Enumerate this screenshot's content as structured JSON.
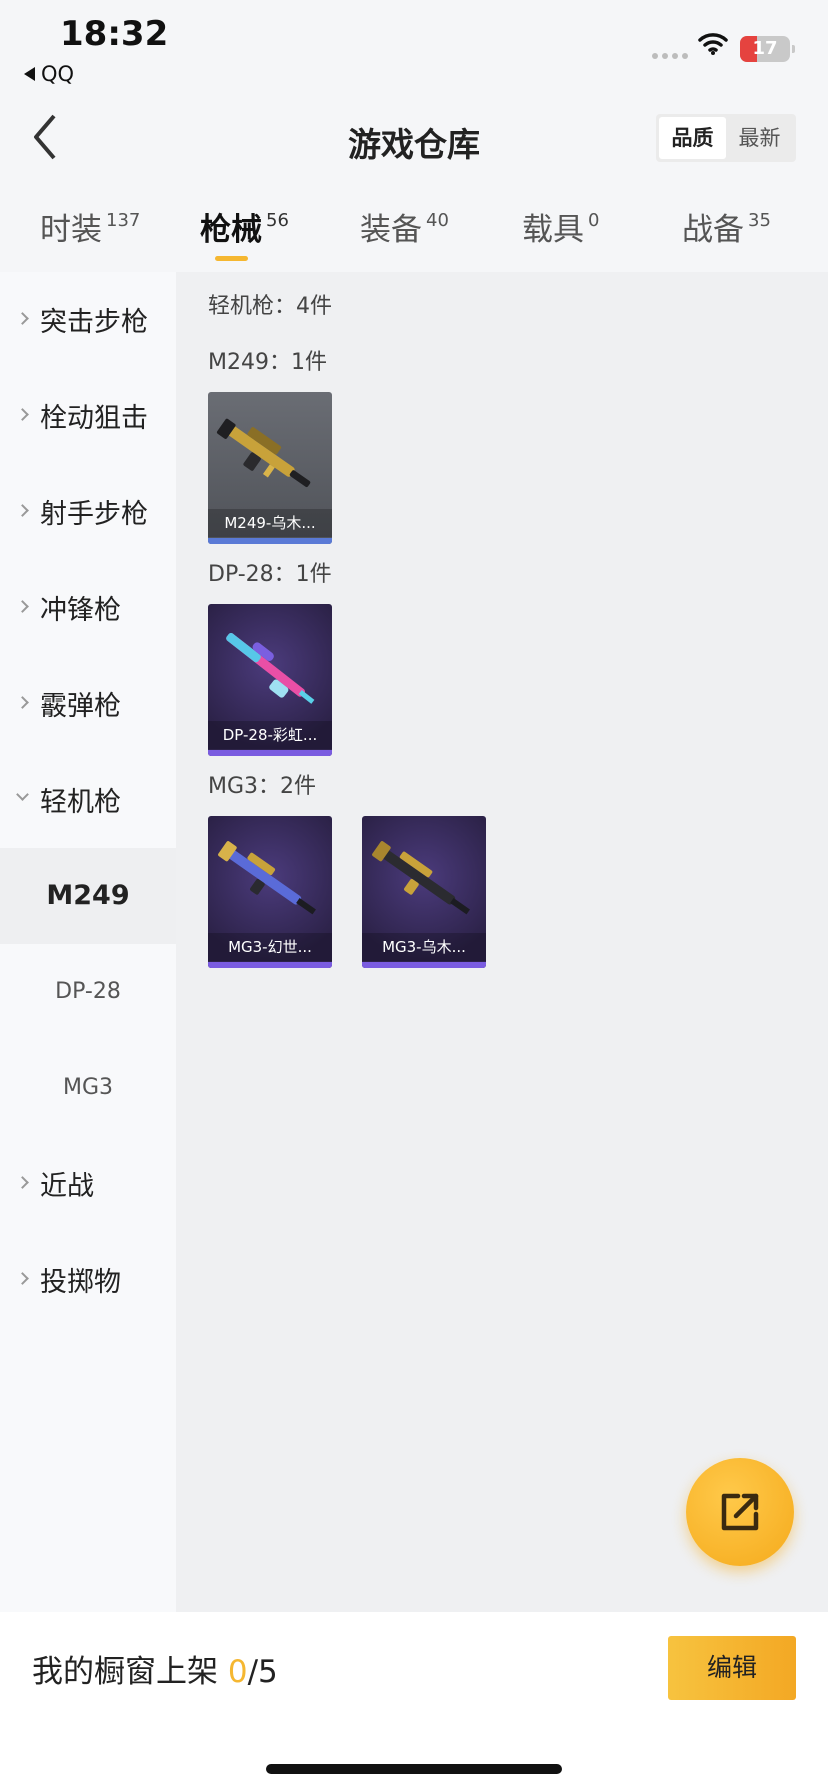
{
  "status_bar": {
    "time": "18:32",
    "back_app": "QQ",
    "battery": "17"
  },
  "header": {
    "title": "游戏仓库",
    "sort_options": [
      "品质",
      "最新"
    ]
  },
  "tabs": [
    {
      "label": "时装",
      "count": "137"
    },
    {
      "label": "枪械",
      "count": "56"
    },
    {
      "label": "装备",
      "count": "40"
    },
    {
      "label": "载具",
      "count": "0"
    },
    {
      "label": "战备",
      "count": "35"
    }
  ],
  "sidebar": {
    "categories": [
      "突击步枪",
      "栓动狙击",
      "射手步枪",
      "冲锋枪",
      "霰弹枪",
      "轻机枪",
      "近战",
      "投掷物"
    ],
    "subitems": [
      "M249",
      "DP-28",
      "MG3"
    ]
  },
  "content": {
    "section_label": "轻机枪：4件",
    "groups": [
      {
        "label": "M249：1件",
        "items": [
          "M249-乌木..."
        ]
      },
      {
        "label": "DP-28：1件",
        "items": [
          "DP-28-彩虹..."
        ]
      },
      {
        "label": "MG3：2件",
        "items": [
          "MG3-幻世...",
          "MG3-乌木..."
        ]
      }
    ]
  },
  "bottom_bar": {
    "prefix": "我的橱窗上架 ",
    "current": "0",
    "suffix": "/5",
    "edit_label": "编辑"
  },
  "colors": {
    "accent": "#f5b731",
    "card_grey": "#5b5e65",
    "card_purple": "#3a2e63"
  },
  "icons": [
    "back-chevron-icon",
    "wifi-icon",
    "battery-icon",
    "share-export-icon"
  ]
}
